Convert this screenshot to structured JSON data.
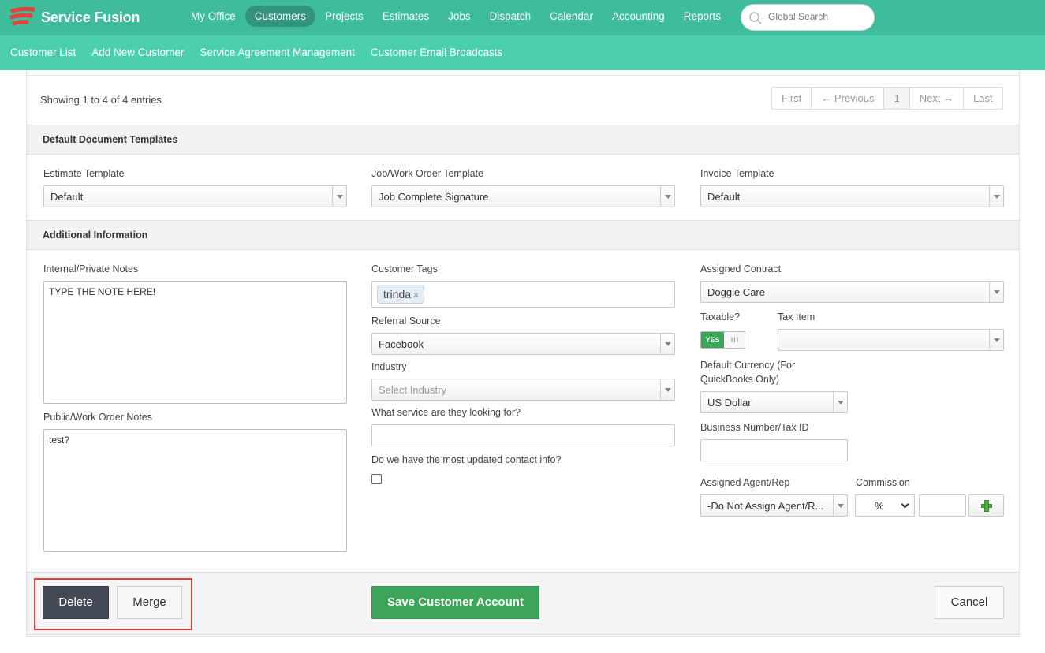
{
  "brand": {
    "name": "Service Fusion",
    "accent": "#3fbc9c"
  },
  "nav": {
    "items": [
      {
        "label": "My Office",
        "active": false
      },
      {
        "label": "Customers",
        "active": true
      },
      {
        "label": "Projects",
        "active": false
      },
      {
        "label": "Estimates",
        "active": false
      },
      {
        "label": "Jobs",
        "active": false
      },
      {
        "label": "Dispatch",
        "active": false
      },
      {
        "label": "Calendar",
        "active": false
      },
      {
        "label": "Accounting",
        "active": false
      },
      {
        "label": "Reports",
        "active": false
      }
    ],
    "search_placeholder": "Global Search"
  },
  "subnav": {
    "items": [
      "Customer List",
      "Add New Customer",
      "Service Agreement Management",
      "Customer Email Broadcasts"
    ]
  },
  "table_info": {
    "showing": "Showing 1 to 4 of 4 entries",
    "pager": {
      "first": "First",
      "previous": "← Previous",
      "current": "1",
      "next": "Next →",
      "last": "Last"
    }
  },
  "templates": {
    "header": "Default Document Templates",
    "estimate": {
      "label": "Estimate Template",
      "value": "Default"
    },
    "job": {
      "label": "Job/Work Order Template",
      "value": "Job Complete Signature"
    },
    "invoice": {
      "label": "Invoice Template",
      "value": "Default"
    }
  },
  "additional": {
    "header": "Additional Information",
    "private_notes": {
      "label": "Internal/Private Notes",
      "value": "TYPE THE NOTE HERE!"
    },
    "public_notes": {
      "label": "Public/Work Order Notes",
      "value": "test?"
    },
    "customer_tags": {
      "label": "Customer Tags",
      "tags": [
        "trinda"
      ],
      "remove_glyph": "×"
    },
    "referral_source": {
      "label": "Referral Source",
      "value": "Facebook"
    },
    "industry": {
      "label": "Industry",
      "placeholder": "Select Industry"
    },
    "service_question": {
      "label": "What service are they looking for?",
      "value": ""
    },
    "contact_question": {
      "label": "Do we have the most updated contact info?",
      "checked": false
    },
    "assigned_contract": {
      "label": "Assigned Contract",
      "value": "Doggie Care"
    },
    "taxable": {
      "label": "Taxable?",
      "on_text": "YES",
      "grip": "III",
      "on": true
    },
    "tax_item": {
      "label": "Tax Item",
      "value": ""
    },
    "currency": {
      "label_line1": "Default Currency (For",
      "label_line2": "QuickBooks Only)",
      "value": "US Dollar"
    },
    "business_number": {
      "label": "Business Number/Tax ID",
      "value": ""
    },
    "agent": {
      "label": "Assigned Agent/Rep",
      "value": "-Do Not Assign Agent/R..."
    },
    "commission": {
      "label": "Commission",
      "type": "%",
      "value": ""
    }
  },
  "footer": {
    "delete": "Delete",
    "merge": "Merge",
    "save": "Save Customer Account",
    "cancel": "Cancel",
    "highlight_color": "#e63b3b"
  }
}
